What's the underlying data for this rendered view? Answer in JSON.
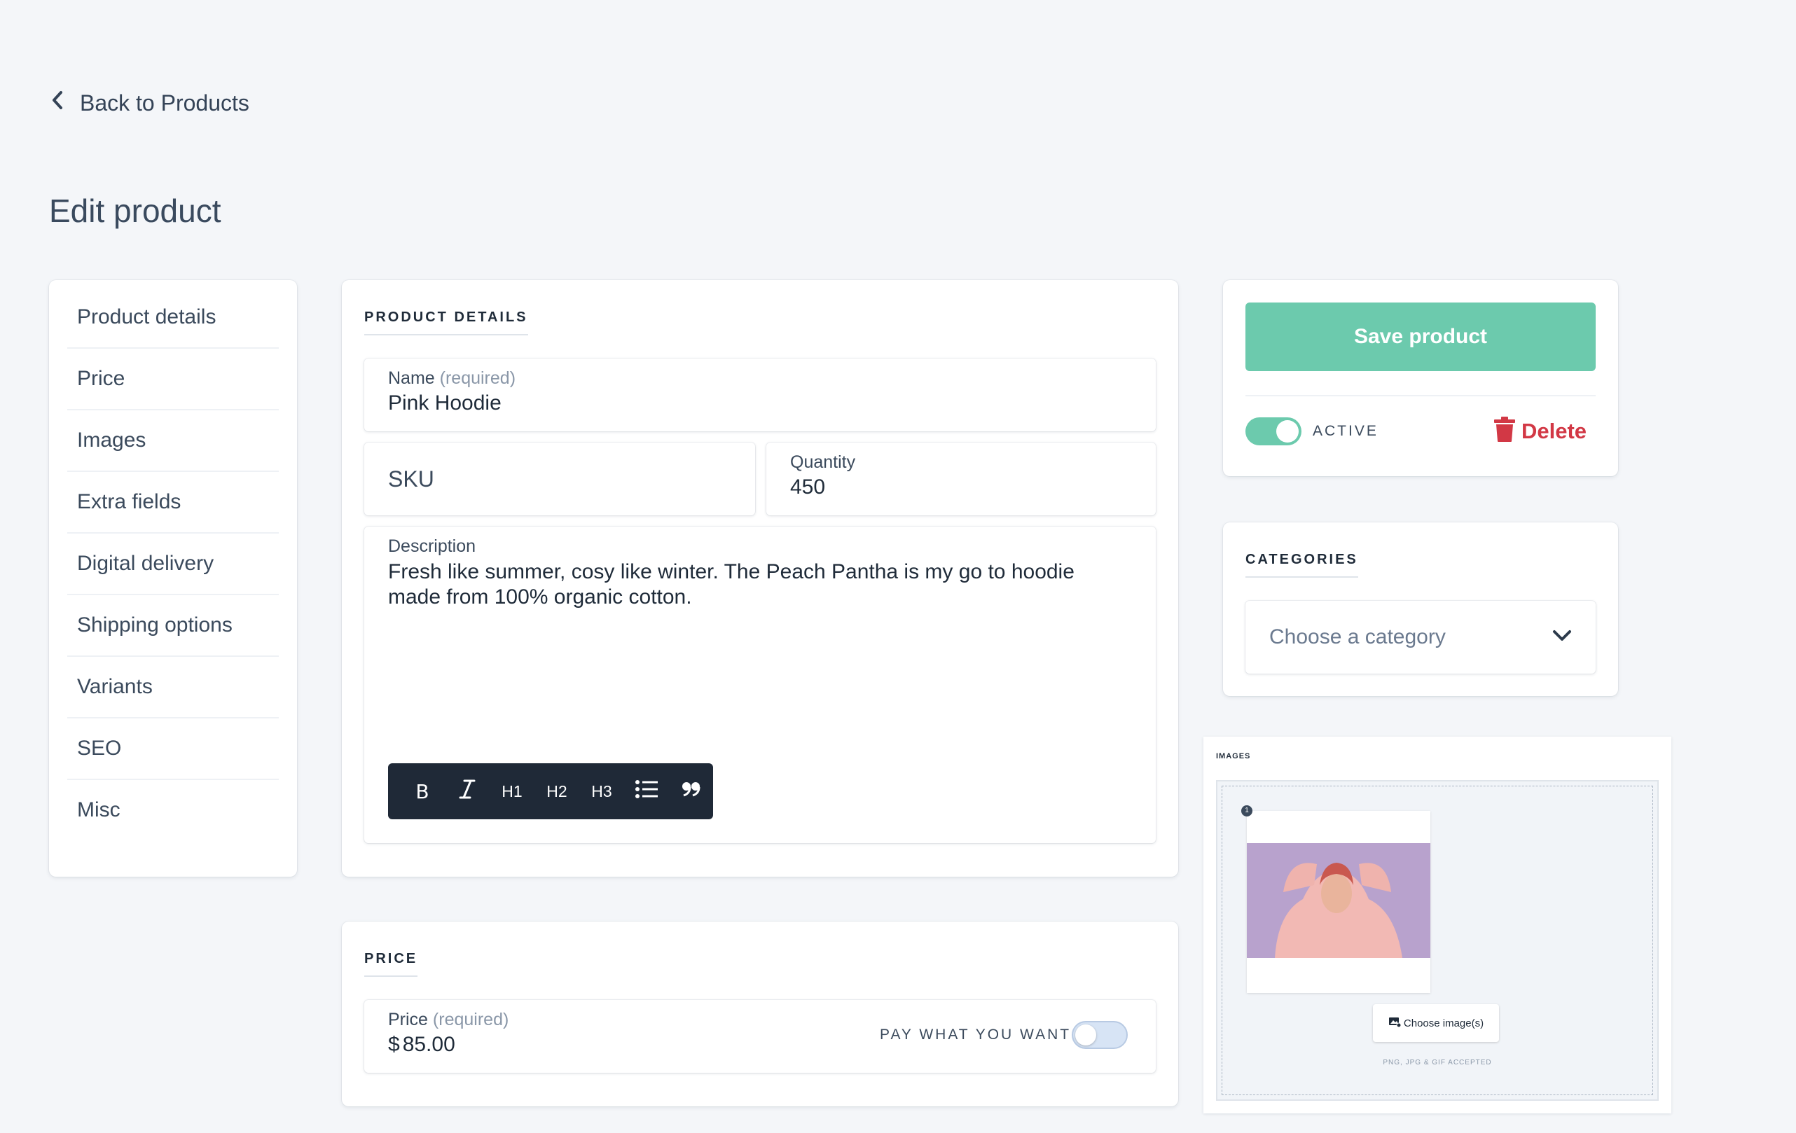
{
  "nav": {
    "back_label": "Back to Products"
  },
  "page": {
    "title": "Edit product"
  },
  "sidebar": {
    "items": [
      {
        "label": "Product details"
      },
      {
        "label": "Price"
      },
      {
        "label": "Images"
      },
      {
        "label": "Extra fields"
      },
      {
        "label": "Digital delivery"
      },
      {
        "label": "Shipping options"
      },
      {
        "label": "Variants"
      },
      {
        "label": "SEO"
      },
      {
        "label": "Misc"
      }
    ]
  },
  "product_details": {
    "section_title": "PRODUCT DETAILS",
    "name": {
      "label": "Name",
      "required": "(required)",
      "value": "Pink Hoodie"
    },
    "sku": {
      "placeholder": "SKU"
    },
    "quantity": {
      "label": "Quantity",
      "value": "450"
    },
    "description": {
      "label": "Description",
      "value": "Fresh like summer, cosy like winter. The Peach Pantha is my go to hoodie made from 100% organic cotton."
    },
    "toolbar": {
      "bold": "B",
      "italic": "I",
      "h1": "H1",
      "h2": "H2",
      "h3": "H3",
      "list": "list-icon",
      "quote": "quote-icon"
    }
  },
  "price": {
    "section_title": "PRICE",
    "label": "Price",
    "required": "(required)",
    "currency": "$",
    "value": "85.00",
    "pay_what_you_want_label": "PAY WHAT YOU WANT",
    "pay_what_you_want_on": false
  },
  "actions": {
    "save_label": "Save product",
    "active_label": "ACTIVE",
    "active_on": true,
    "delete_label": "Delete"
  },
  "categories": {
    "section_title": "CATEGORIES",
    "placeholder": "Choose a category"
  },
  "images": {
    "section_title": "IMAGES",
    "badge": "1",
    "choose_label": "Choose image(s)",
    "accepted": "PNG, JPG & GIF ACCEPTED"
  },
  "colors": {
    "accent": "#6ccaad",
    "danger": "#d23845",
    "toolbar_bg": "#1f2937",
    "page_bg": "#f4f6f9"
  }
}
